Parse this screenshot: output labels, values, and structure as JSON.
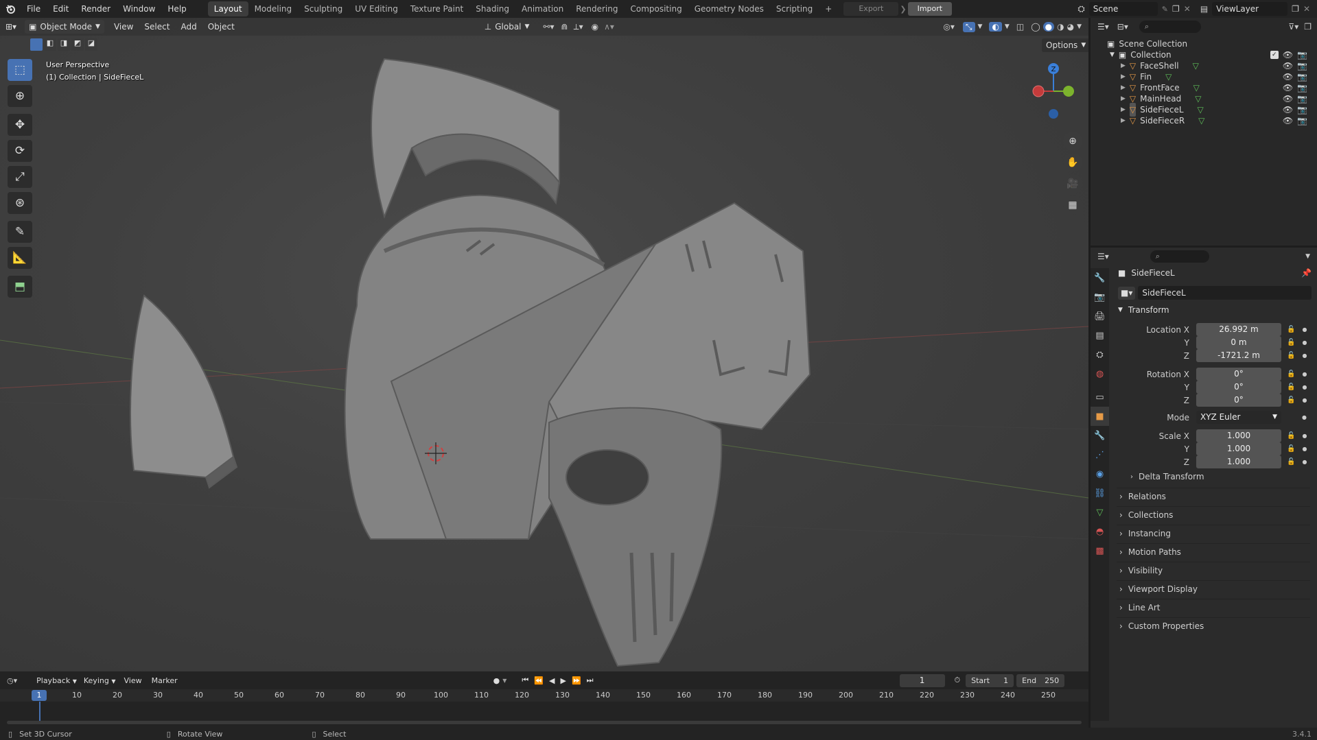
{
  "app": {
    "name": "Blender",
    "version": "3.4.1"
  },
  "menu": [
    "File",
    "Edit",
    "Render",
    "Window",
    "Help"
  ],
  "workspaces": [
    {
      "label": "Layout",
      "active": true
    },
    {
      "label": "Modeling"
    },
    {
      "label": "Sculpting"
    },
    {
      "label": "UV Editing"
    },
    {
      "label": "Texture Paint"
    },
    {
      "label": "Shading"
    },
    {
      "label": "Animation"
    },
    {
      "label": "Rendering"
    },
    {
      "label": "Compositing"
    },
    {
      "label": "Geometry Nodes"
    },
    {
      "label": "Scripting"
    }
  ],
  "topbar": {
    "add_tab": "+",
    "export": "Export",
    "import": "Import",
    "scene": "Scene",
    "view_layer": "ViewLayer"
  },
  "viewport": {
    "mode": "Object Mode",
    "menus": [
      "View",
      "Select",
      "Add",
      "Object"
    ],
    "orientation": "Global",
    "options": "Options",
    "overlay_title": "User Perspective",
    "overlay_subtitle": "(1) Collection | SideFieceL",
    "gizmo_z": "Z"
  },
  "outliner": {
    "scene_collection": "Scene Collection",
    "collection": "Collection",
    "objects": [
      "FaceShell",
      "Fin",
      "FrontFace",
      "MainHead",
      "SideFieceL",
      "SideFieceR"
    ],
    "selected": "SideFieceL"
  },
  "properties": {
    "object_name": "SideFieceL",
    "datablock_name": "SideFieceL",
    "transform_title": "Transform",
    "location": {
      "label_x": "Location X",
      "x": "26.992 m",
      "y": "0 m",
      "z": "-1721.2 m"
    },
    "rotation": {
      "label_x": "Rotation X",
      "x": "0°",
      "y": "0°",
      "z": "0°"
    },
    "mode_label": "Mode",
    "mode_value": "XYZ Euler",
    "scale": {
      "label_x": "Scale X",
      "x": "1.000",
      "y": "1.000",
      "z": "1.000"
    },
    "axis_y": "Y",
    "axis_z": "Z",
    "delta_transform": "Delta Transform",
    "sections": [
      "Relations",
      "Collections",
      "Instancing",
      "Motion Paths",
      "Visibility",
      "Viewport Display",
      "Line Art",
      "Custom Properties"
    ]
  },
  "timeline": {
    "menus": [
      "Playback",
      "Keying",
      "View",
      "Marker"
    ],
    "current_frame": "1",
    "start_label": "Start",
    "start": "1",
    "end_label": "End",
    "end": "250",
    "ticks": [
      "10",
      "20",
      "30",
      "40",
      "50",
      "60",
      "70",
      "80",
      "90",
      "100",
      "110",
      "120",
      "130",
      "140",
      "150",
      "160",
      "170",
      "180",
      "190",
      "200",
      "210",
      "220",
      "230",
      "240",
      "250"
    ]
  },
  "statusbar": {
    "left": "Set 3D Cursor",
    "mid": "Rotate View",
    "right": "Select"
  },
  "colors": {
    "accent": "#4772b3",
    "mesh_icon": "#e69a47",
    "data_icon": "#5fbf59"
  }
}
